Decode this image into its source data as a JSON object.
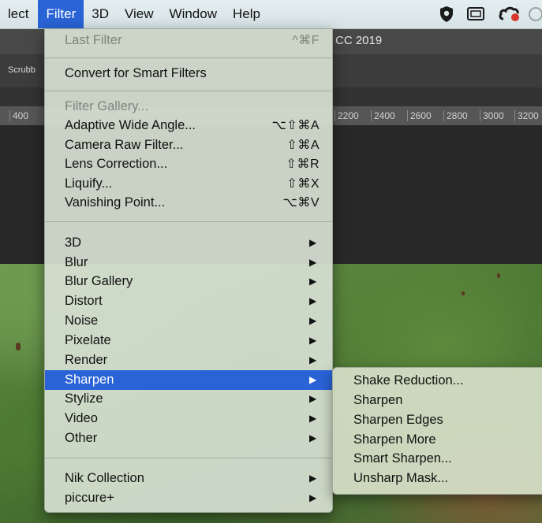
{
  "menubar": {
    "items": [
      "lect",
      "Filter",
      "3D",
      "View",
      "Window",
      "Help"
    ],
    "active_index": 1,
    "status_icons": [
      "shield-icon",
      "display-icon",
      "creative-cloud-icon"
    ]
  },
  "app": {
    "title": "CC 2019",
    "options_bar_text": "Scrubb",
    "ruler_ticks": [
      "400",
      "2200",
      "2400",
      "2600",
      "2800",
      "3000",
      "3200"
    ]
  },
  "filter_menu": {
    "last_filter": {
      "label": "Last Filter",
      "shortcut": "^⌘F",
      "disabled": true
    },
    "convert": {
      "label": "Convert for Smart Filters"
    },
    "filter_gallery": {
      "label": "Filter Gallery...",
      "disabled": true
    },
    "filters": [
      {
        "label": "Adaptive Wide Angle...",
        "shortcut": "⌥⇧⌘A"
      },
      {
        "label": "Camera Raw Filter...",
        "shortcut": "⇧⌘A"
      },
      {
        "label": "Lens Correction...",
        "shortcut": "⇧⌘R"
      },
      {
        "label": "Liquify...",
        "shortcut": "⇧⌘X"
      },
      {
        "label": "Vanishing Point...",
        "shortcut": "⌥⌘V"
      }
    ],
    "submenus": [
      {
        "label": "3D"
      },
      {
        "label": "Blur"
      },
      {
        "label": "Blur Gallery"
      },
      {
        "label": "Distort"
      },
      {
        "label": "Noise"
      },
      {
        "label": "Pixelate"
      },
      {
        "label": "Render"
      },
      {
        "label": "Sharpen",
        "active": true
      },
      {
        "label": "Stylize"
      },
      {
        "label": "Video"
      },
      {
        "label": "Other"
      }
    ],
    "plugins": [
      {
        "label": "Nik Collection"
      },
      {
        "label": "piccure+"
      }
    ],
    "arrow_glyph": "▶"
  },
  "sharpen_submenu": {
    "items": [
      "Shake Reduction...",
      "Sharpen",
      "Sharpen Edges",
      "Sharpen More",
      "Smart Sharpen...",
      "Unsharp Mask..."
    ]
  },
  "colors": {
    "highlight": "#2a63d6",
    "menu_bg": "#d6e0d2",
    "disabled_text": "#7d857d"
  }
}
